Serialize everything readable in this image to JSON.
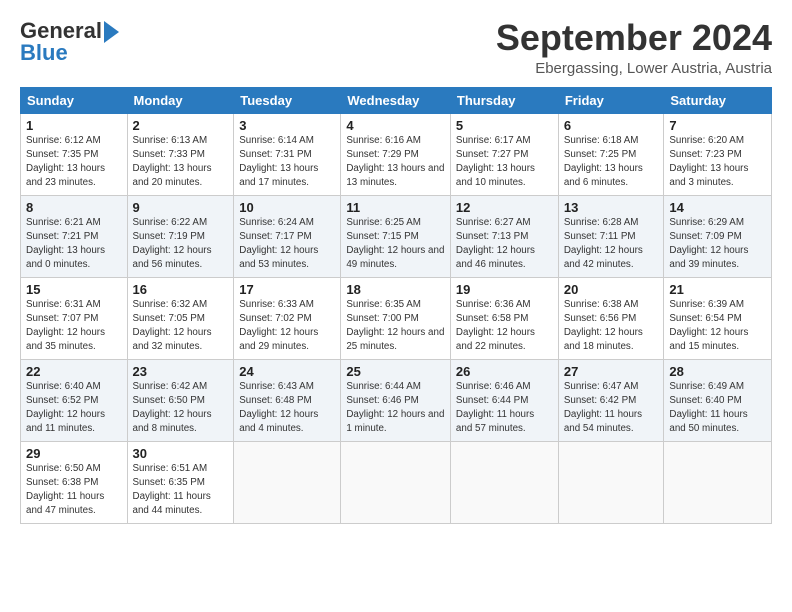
{
  "header": {
    "logo_general": "General",
    "logo_blue": "Blue",
    "month_title": "September 2024",
    "location": "Ebergassing, Lower Austria, Austria"
  },
  "columns": [
    "Sunday",
    "Monday",
    "Tuesday",
    "Wednesday",
    "Thursday",
    "Friday",
    "Saturday"
  ],
  "weeks": [
    [
      {
        "day": "1",
        "sunrise": "Sunrise: 6:12 AM",
        "sunset": "Sunset: 7:35 PM",
        "daylight": "Daylight: 13 hours and 23 minutes."
      },
      {
        "day": "2",
        "sunrise": "Sunrise: 6:13 AM",
        "sunset": "Sunset: 7:33 PM",
        "daylight": "Daylight: 13 hours and 20 minutes."
      },
      {
        "day": "3",
        "sunrise": "Sunrise: 6:14 AM",
        "sunset": "Sunset: 7:31 PM",
        "daylight": "Daylight: 13 hours and 17 minutes."
      },
      {
        "day": "4",
        "sunrise": "Sunrise: 6:16 AM",
        "sunset": "Sunset: 7:29 PM",
        "daylight": "Daylight: 13 hours and 13 minutes."
      },
      {
        "day": "5",
        "sunrise": "Sunrise: 6:17 AM",
        "sunset": "Sunset: 7:27 PM",
        "daylight": "Daylight: 13 hours and 10 minutes."
      },
      {
        "day": "6",
        "sunrise": "Sunrise: 6:18 AM",
        "sunset": "Sunset: 7:25 PM",
        "daylight": "Daylight: 13 hours and 6 minutes."
      },
      {
        "day": "7",
        "sunrise": "Sunrise: 6:20 AM",
        "sunset": "Sunset: 7:23 PM",
        "daylight": "Daylight: 13 hours and 3 minutes."
      }
    ],
    [
      {
        "day": "8",
        "sunrise": "Sunrise: 6:21 AM",
        "sunset": "Sunset: 7:21 PM",
        "daylight": "Daylight: 13 hours and 0 minutes."
      },
      {
        "day": "9",
        "sunrise": "Sunrise: 6:22 AM",
        "sunset": "Sunset: 7:19 PM",
        "daylight": "Daylight: 12 hours and 56 minutes."
      },
      {
        "day": "10",
        "sunrise": "Sunrise: 6:24 AM",
        "sunset": "Sunset: 7:17 PM",
        "daylight": "Daylight: 12 hours and 53 minutes."
      },
      {
        "day": "11",
        "sunrise": "Sunrise: 6:25 AM",
        "sunset": "Sunset: 7:15 PM",
        "daylight": "Daylight: 12 hours and 49 minutes."
      },
      {
        "day": "12",
        "sunrise": "Sunrise: 6:27 AM",
        "sunset": "Sunset: 7:13 PM",
        "daylight": "Daylight: 12 hours and 46 minutes."
      },
      {
        "day": "13",
        "sunrise": "Sunrise: 6:28 AM",
        "sunset": "Sunset: 7:11 PM",
        "daylight": "Daylight: 12 hours and 42 minutes."
      },
      {
        "day": "14",
        "sunrise": "Sunrise: 6:29 AM",
        "sunset": "Sunset: 7:09 PM",
        "daylight": "Daylight: 12 hours and 39 minutes."
      }
    ],
    [
      {
        "day": "15",
        "sunrise": "Sunrise: 6:31 AM",
        "sunset": "Sunset: 7:07 PM",
        "daylight": "Daylight: 12 hours and 35 minutes."
      },
      {
        "day": "16",
        "sunrise": "Sunrise: 6:32 AM",
        "sunset": "Sunset: 7:05 PM",
        "daylight": "Daylight: 12 hours and 32 minutes."
      },
      {
        "day": "17",
        "sunrise": "Sunrise: 6:33 AM",
        "sunset": "Sunset: 7:02 PM",
        "daylight": "Daylight: 12 hours and 29 minutes."
      },
      {
        "day": "18",
        "sunrise": "Sunrise: 6:35 AM",
        "sunset": "Sunset: 7:00 PM",
        "daylight": "Daylight: 12 hours and 25 minutes."
      },
      {
        "day": "19",
        "sunrise": "Sunrise: 6:36 AM",
        "sunset": "Sunset: 6:58 PM",
        "daylight": "Daylight: 12 hours and 22 minutes."
      },
      {
        "day": "20",
        "sunrise": "Sunrise: 6:38 AM",
        "sunset": "Sunset: 6:56 PM",
        "daylight": "Daylight: 12 hours and 18 minutes."
      },
      {
        "day": "21",
        "sunrise": "Sunrise: 6:39 AM",
        "sunset": "Sunset: 6:54 PM",
        "daylight": "Daylight: 12 hours and 15 minutes."
      }
    ],
    [
      {
        "day": "22",
        "sunrise": "Sunrise: 6:40 AM",
        "sunset": "Sunset: 6:52 PM",
        "daylight": "Daylight: 12 hours and 11 minutes."
      },
      {
        "day": "23",
        "sunrise": "Sunrise: 6:42 AM",
        "sunset": "Sunset: 6:50 PM",
        "daylight": "Daylight: 12 hours and 8 minutes."
      },
      {
        "day": "24",
        "sunrise": "Sunrise: 6:43 AM",
        "sunset": "Sunset: 6:48 PM",
        "daylight": "Daylight: 12 hours and 4 minutes."
      },
      {
        "day": "25",
        "sunrise": "Sunrise: 6:44 AM",
        "sunset": "Sunset: 6:46 PM",
        "daylight": "Daylight: 12 hours and 1 minute."
      },
      {
        "day": "26",
        "sunrise": "Sunrise: 6:46 AM",
        "sunset": "Sunset: 6:44 PM",
        "daylight": "Daylight: 11 hours and 57 minutes."
      },
      {
        "day": "27",
        "sunrise": "Sunrise: 6:47 AM",
        "sunset": "Sunset: 6:42 PM",
        "daylight": "Daylight: 11 hours and 54 minutes."
      },
      {
        "day": "28",
        "sunrise": "Sunrise: 6:49 AM",
        "sunset": "Sunset: 6:40 PM",
        "daylight": "Daylight: 11 hours and 50 minutes."
      }
    ],
    [
      {
        "day": "29",
        "sunrise": "Sunrise: 6:50 AM",
        "sunset": "Sunset: 6:38 PM",
        "daylight": "Daylight: 11 hours and 47 minutes."
      },
      {
        "day": "30",
        "sunrise": "Sunrise: 6:51 AM",
        "sunset": "Sunset: 6:35 PM",
        "daylight": "Daylight: 11 hours and 44 minutes."
      },
      null,
      null,
      null,
      null,
      null
    ]
  ]
}
